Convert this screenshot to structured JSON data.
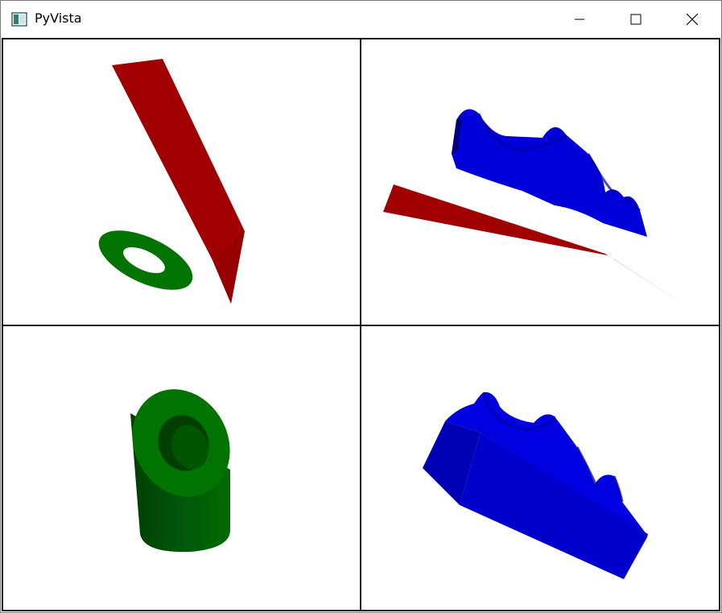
{
  "window": {
    "title": "PyVista",
    "controls": {
      "minimize": "minimize-icon",
      "maximize": "maximize-icon",
      "close": "close-icon"
    }
  },
  "viewports": {
    "top_left": {
      "objects": [
        "red-plane",
        "green-ring"
      ]
    },
    "top_right": {
      "objects": [
        "blue-surface",
        "red-plane"
      ]
    },
    "bottom_left": {
      "objects": [
        "green-tube"
      ]
    },
    "bottom_right": {
      "objects": [
        "blue-extruded-surface"
      ]
    }
  },
  "colors": {
    "red": "#a00000",
    "green": "#007300",
    "blue": "#0000d8",
    "background": "#ffffff",
    "border": "#1a1a1a"
  }
}
